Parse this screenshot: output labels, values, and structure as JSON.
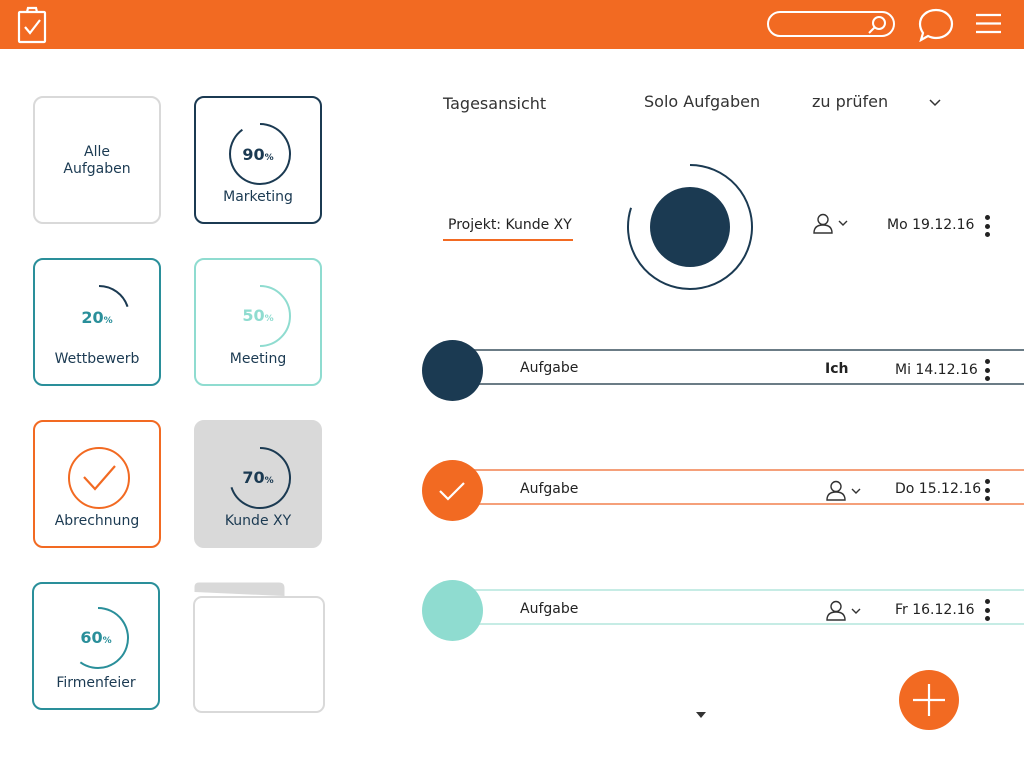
{
  "colors": {
    "accent": "#f26a22",
    "navy": "#1b3a52",
    "teal": "#2a8f9a",
    "mint": "#8fdcd0",
    "grey": "#d9d9d9"
  },
  "header": {
    "logo_icon": "clipboard-check-icon",
    "search_icon": "search-icon",
    "chat_icon": "chat-bubble-icon",
    "menu_icon": "hamburger-menu-icon",
    "search_value": ""
  },
  "tiles": [
    {
      "label_line1": "Alle",
      "label_line2": "Aufgaben"
    },
    {
      "label": "Marketing",
      "percent": "90",
      "percent_sign": "%",
      "progress": 0.9
    },
    {
      "label": "Wettbewerb",
      "percent": "20",
      "percent_sign": "%",
      "progress": 0.2
    },
    {
      "label": "Meeting",
      "percent": "50",
      "percent_sign": "%",
      "progress": 0.5
    },
    {
      "label": "Abrechnung",
      "icon": "checkmark-icon",
      "progress": 1.0
    },
    {
      "label": "Kunde XY",
      "percent": "70",
      "percent_sign": "%",
      "progress": 0.7
    },
    {
      "label": "Firmenfeier",
      "percent": "60",
      "percent_sign": "%",
      "progress": 0.6
    },
    {
      "icon": "folder-icon",
      "label": ""
    }
  ],
  "tabs": {
    "day_view": "Tagesansicht",
    "solo_tasks": "Solo Aufgaben",
    "to_review": "zu prüfen"
  },
  "project": {
    "label": "Projekt: Kunde XY",
    "date": "Mo 19.12.16",
    "progress": 0.8
  },
  "tasks": [
    {
      "title": "Aufgabe",
      "assignee": "Ich",
      "date": "Mi 14.12.16",
      "status": "open",
      "color": "#1b3a52"
    },
    {
      "title": "Aufgabe",
      "assignee": "",
      "date": "Do 15.12.16",
      "status": "done",
      "color": "#f26a22"
    },
    {
      "title": "Aufgabe",
      "assignee": "",
      "date": "Fr 16.12.16",
      "status": "open",
      "color": "#8fdcd0"
    }
  ],
  "add_button_icon": "plus-icon"
}
